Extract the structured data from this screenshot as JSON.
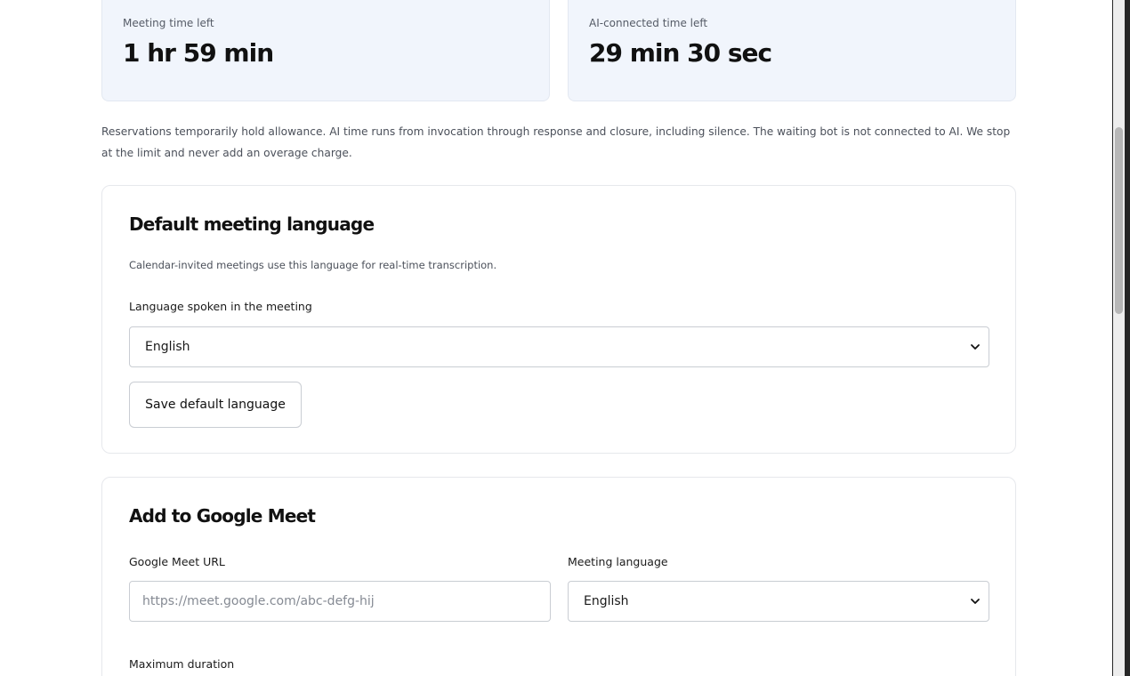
{
  "stats": {
    "meeting_time": {
      "label": "Meeting time left",
      "value": "1 hr 59 min"
    },
    "ai_time": {
      "label": "AI-connected time left",
      "value": "29 min 30 sec"
    }
  },
  "note": "Reservations temporarily hold allowance. AI time runs from invocation through response and closure, including silence. The waiting bot is not connected to AI. We stop at the limit and never add an overage charge.",
  "default_language": {
    "title": "Default meeting language",
    "description": "Calendar-invited meetings use this language for real-time transcription.",
    "field_label": "Language spoken in the meeting",
    "selected": "English",
    "save_label": "Save default language"
  },
  "google_meet": {
    "title": "Add to Google Meet",
    "url_label": "Google Meet URL",
    "url_placeholder": "https://meet.google.com/abc-defg-hij",
    "url_value": "",
    "language_label": "Meeting language",
    "language_selected": "English",
    "max_duration_label": "Maximum duration"
  },
  "icons": {
    "select_arrow": "chevron-down-icon"
  },
  "colors": {
    "stat_card_bg": "#f1f5fc",
    "border": "#e6e8ec",
    "text": "#111111"
  }
}
